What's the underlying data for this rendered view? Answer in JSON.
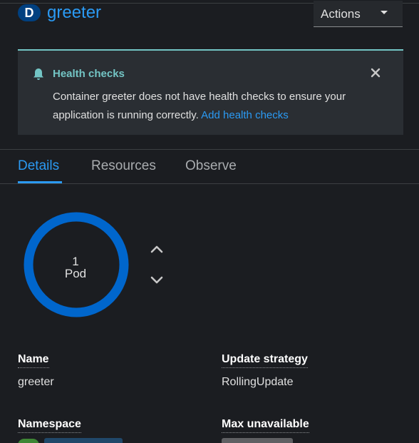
{
  "header": {
    "resource_badge": "D",
    "title": "greeter",
    "actions_label": "Actions"
  },
  "alert": {
    "title": "Health checks",
    "body": "Container greeter does not have health checks to ensure your application is running correctly.",
    "link": "Add health checks"
  },
  "tabs": [
    {
      "label": "Details",
      "active": true
    },
    {
      "label": "Resources",
      "active": false
    },
    {
      "label": "Observe",
      "active": false
    }
  ],
  "pods": {
    "count": "1",
    "unit": "Pod"
  },
  "details": {
    "name_label": "Name",
    "name_value": "greeter",
    "update_strategy_label": "Update strategy",
    "update_strategy_value": "RollingUpdate",
    "namespace_label": "Namespace",
    "max_unavailable_label": "Max unavailable"
  },
  "colors": {
    "accent": "#2b9af3",
    "alert_accent": "#73c5c5",
    "background": "#1b1d21",
    "donut": "#0066cc"
  }
}
